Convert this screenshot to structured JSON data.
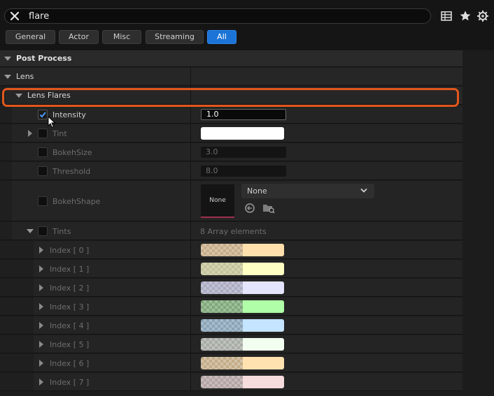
{
  "search": {
    "value": "flare"
  },
  "tabs": [
    {
      "label": "General",
      "active": false
    },
    {
      "label": "Actor",
      "active": false
    },
    {
      "label": "Misc",
      "active": false
    },
    {
      "label": "Streaming",
      "active": false
    },
    {
      "label": "All",
      "active": true
    }
  ],
  "tree": {
    "post_process": "Post Process",
    "lens": "Lens",
    "lens_flares": "Lens Flares"
  },
  "properties": {
    "intensity": {
      "label": "Intensity",
      "value": "1.0",
      "enabled": true
    },
    "tint": {
      "label": "Tint",
      "color": "#ffffff",
      "enabled": false
    },
    "bokeh_size": {
      "label": "BokehSize",
      "value": "3.0",
      "enabled": false
    },
    "threshold": {
      "label": "Threshold",
      "value": "8.0",
      "enabled": false
    },
    "bokeh_shape": {
      "label": "BokehShape",
      "thumb_text": "None",
      "dropdown_value": "None",
      "enabled": false
    },
    "tints": {
      "label": "Tints",
      "summary": "8 Array elements",
      "enabled": false
    }
  },
  "tint_elements": [
    {
      "label": "Index [ 0 ]",
      "color": "#ffe0ad"
    },
    {
      "label": "Index [ 1 ]",
      "color": "#ffffc4"
    },
    {
      "label": "Index [ 2 ]",
      "color": "#e4e4fc"
    },
    {
      "label": "Index [ 3 ]",
      "color": "#b0ffa8"
    },
    {
      "label": "Index [ 4 ]",
      "color": "#c4e4ff"
    },
    {
      "label": "Index [ 5 ]",
      "color": "#f2fff0"
    },
    {
      "label": "Index [ 6 ]",
      "color": "#ffe2b0"
    },
    {
      "label": "Index [ 7 ]",
      "color": "#f6dcdc"
    }
  ],
  "colors": {
    "accent": "#1b74d6",
    "highlight": "#e2571d",
    "panel": "#242424"
  },
  "icons": [
    "close-icon",
    "table-view-icon",
    "star-icon",
    "gear-icon",
    "reset-arrow-icon",
    "browse-folder-icon",
    "chevron-down-icon"
  ]
}
